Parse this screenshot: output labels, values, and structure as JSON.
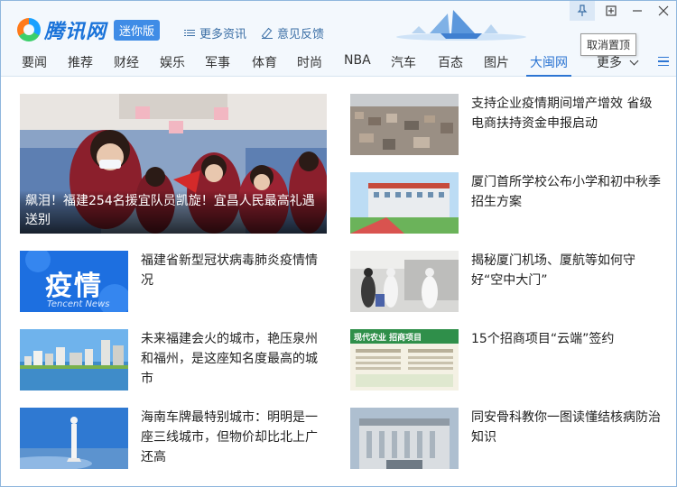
{
  "header": {
    "logo_text": "腾讯网",
    "logo_badge": "迷你版",
    "more_news": "更多资讯",
    "feedback": "意见反馈",
    "tooltip": "取消置顶"
  },
  "window_controls": {
    "pin_icon": "pin-icon",
    "restore_icon": "restore-icon",
    "minimize_icon": "minimize-icon",
    "close_icon": "close-icon"
  },
  "nav": {
    "items": [
      "要闻",
      "推荐",
      "财经",
      "娱乐",
      "军事",
      "体育",
      "时尚",
      "NBA",
      "汽车",
      "百态",
      "图片",
      "大闽网"
    ],
    "more": "更多",
    "active_index": 11,
    "accent_color": "#2c75d3"
  },
  "articles": {
    "hero": {
      "title": "飙泪！福建254名援宜队员凯旋！宜昌人民最高礼遇送别"
    },
    "left": [
      {
        "title": "福建省新型冠状病毒肺炎疫情情况",
        "thumb_text": "疫情",
        "thumb_sub": "Tencent News"
      },
      {
        "title": "未来福建会火的城市，艳压泉州和福州，是这座知名度最高的城市"
      },
      {
        "title": "海南车牌最特别城市：明明是一座三线城市，但物价却比北上广还高"
      }
    ],
    "right": [
      {
        "title": "支持企业疫情期间增产增效 省级电商扶持资金申报启动"
      },
      {
        "title": "厦门首所学校公布小学和初中秋季招生方案"
      },
      {
        "title": "揭秘厦门机场、厦航等如何守好“空中大门”"
      },
      {
        "title": "15个招商项目“云端”签约",
        "thumb_text": "现代农业 招商项目"
      },
      {
        "title": "同安骨科教你一图读懂结核病防治知识"
      }
    ]
  }
}
